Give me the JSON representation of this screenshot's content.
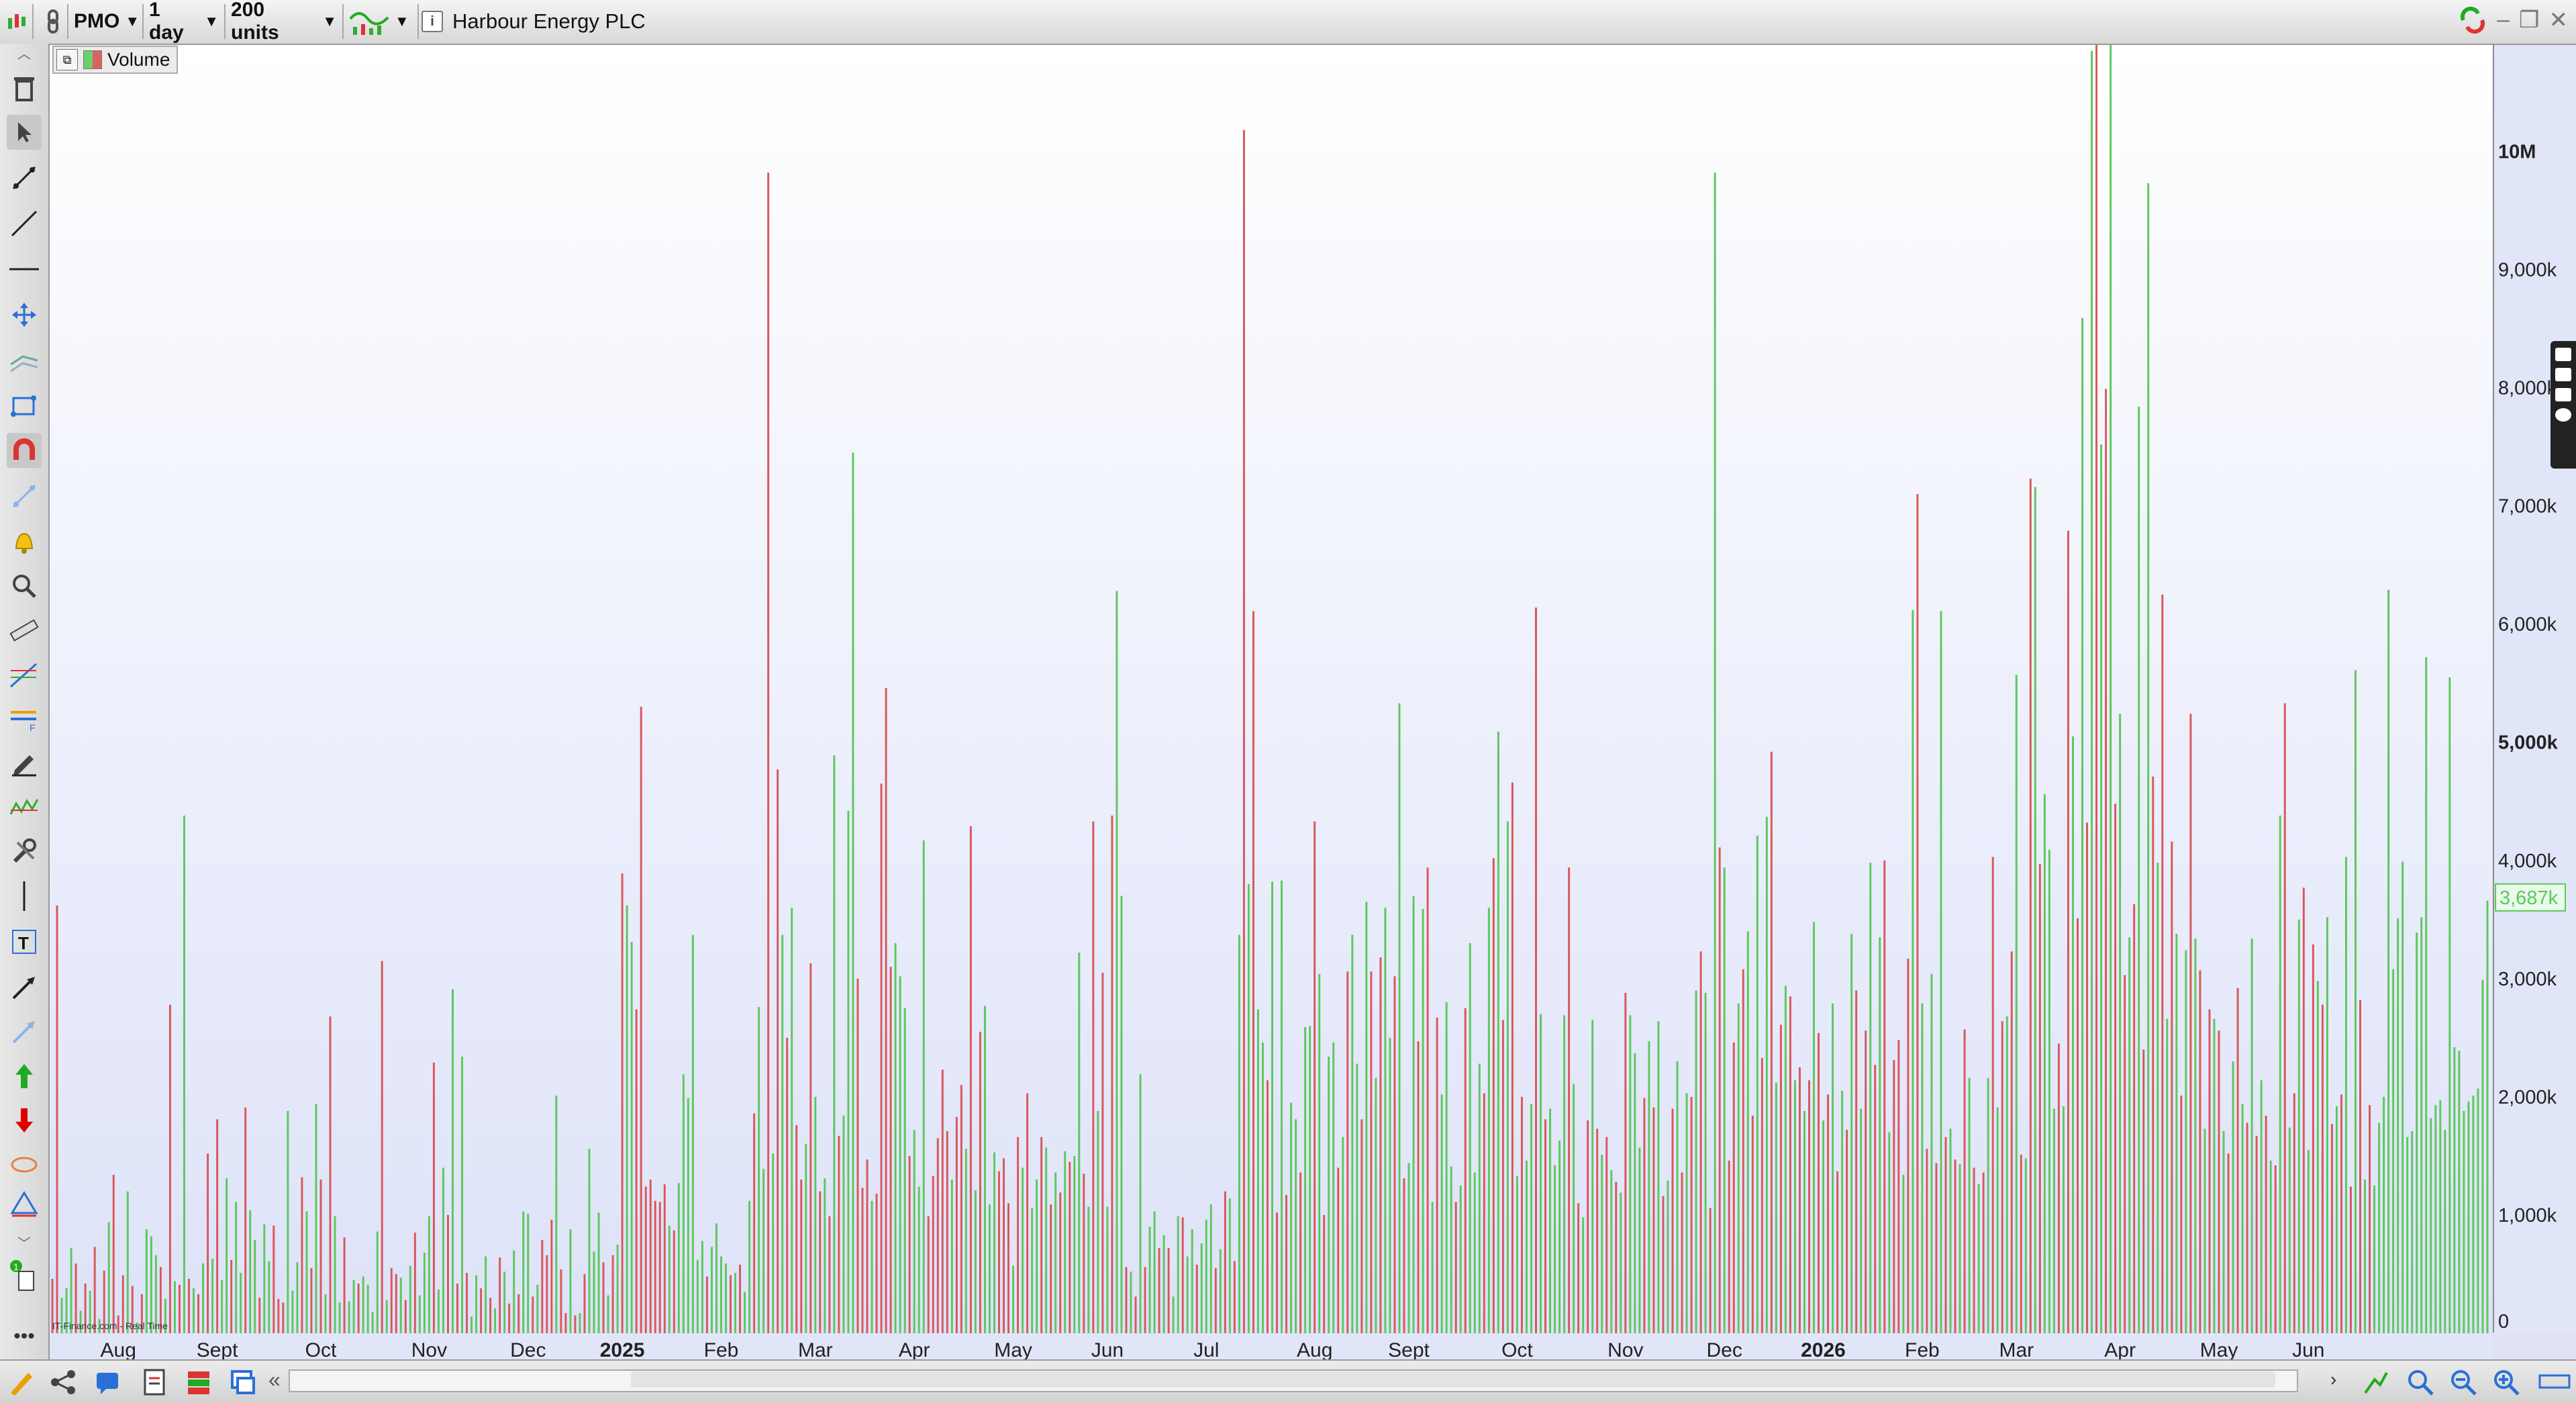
{
  "toolbar": {
    "symbol": "PMO",
    "interval": "1 day",
    "units": "200 units",
    "title": "Harbour Energy PLC"
  },
  "legend": {
    "label": "Volume"
  },
  "credit": "IT-Finance.com - Real Time",
  "colors": {
    "up": "#5cc85c",
    "down": "#d9575b",
    "current": "#5cc85c"
  },
  "chart_data": {
    "type": "bar",
    "title": "",
    "xlabel": "",
    "ylabel": "",
    "ylim": [
      0,
      10900000
    ],
    "y_ticks": [
      {
        "value": 0,
        "label": "0"
      },
      {
        "value": 1000000,
        "label": "1,000k"
      },
      {
        "value": 2000000,
        "label": "2,000k"
      },
      {
        "value": 3000000,
        "label": "3,000k"
      },
      {
        "value": 4000000,
        "label": "4,000k"
      },
      {
        "value": 5000000,
        "label": "5,000k"
      },
      {
        "value": 6000000,
        "label": "6,000k"
      },
      {
        "value": 7000000,
        "label": "7,000k"
      },
      {
        "value": 8000000,
        "label": "8,000k"
      },
      {
        "value": 9000000,
        "label": "9,000k"
      },
      {
        "value": 10000000,
        "label": "10M"
      }
    ],
    "bold_ticks": [
      "5,000k",
      "10M"
    ],
    "current_value_label": "3,687k",
    "current_value": 3687000,
    "x_ticks": [
      {
        "label": "Aug",
        "index": 14
      },
      {
        "label": "Sept",
        "index": 35
      },
      {
        "label": "Oct",
        "index": 57
      },
      {
        "label": "Nov",
        "index": 80
      },
      {
        "label": "Dec",
        "index": 101
      },
      {
        "label": "2025",
        "index": 121
      },
      {
        "label": "Feb",
        "index": 142
      },
      {
        "label": "Mar",
        "index": 162
      },
      {
        "label": "Apr",
        "index": 183
      },
      {
        "label": "May",
        "index": 204
      },
      {
        "label": "Jun",
        "index": 224
      },
      {
        "label": "Jul",
        "index": 245
      },
      {
        "label": "Aug",
        "index": 268
      },
      {
        "label": "Sept",
        "index": 288
      },
      {
        "label": "Oct",
        "index": 311
      },
      {
        "label": "Nov",
        "index": 334
      },
      {
        "label": "Dec",
        "index": 355
      },
      {
        "label": "2026",
        "index": 376
      },
      {
        "label": "Feb",
        "index": 397
      },
      {
        "label": "Mar",
        "index": 417
      },
      {
        "label": "Apr",
        "index": 439
      },
      {
        "label": "May",
        "index": 460
      },
      {
        "label": "Jun",
        "index": 479
      }
    ],
    "bold_x_ticks": [
      "2025",
      "2026"
    ],
    "series": [
      {
        "values": [
          460,
          3620,
          300,
          380,
          720,
          590,
          190,
          420,
          360,
          730,
          120,
          530,
          940,
          1340,
          150,
          490,
          1200,
          400,
          90,
          330,
          880,
          820,
          660,
          560,
          290,
          2780,
          440,
          410,
          4380,
          460,
          380,
          330,
          590,
          1520,
          630,
          1810,
          450,
          1310,
          620,
          1110,
          510,
          1910,
          1040,
          790,
          300,
          920,
          610,
          910,
          290,
          260,
          1880,
          360,
          600,
          1320,
          1030,
          550,
          1940,
          1300,
          330,
          2680,
          990,
          260,
          810,
          270,
          450,
          420,
          480,
          410,
          180,
          860,
          3150,
          280,
          550,
          500,
          470,
          280,
          570,
          850,
          320,
          680,
          990,
          2290,
          370,
          1400,
          1000,
          2910,
          420,
          2340,
          510,
          140,
          490,
          380,
          650,
          300,
          210,
          640,
          520,
          250,
          700,
          330,
          1030,
          1010,
          310,
          410,
          790,
          660,
          960,
          2010,
          540,
          170,
          880,
          150,
          170,
          500,
          1560,
          690,
          1020,
          600,
          320,
          660,
          750,
          3890,
          3620,
          3310,
          2740,
          5300,
          1240,
          1300,
          1120,
          1110,
          1260,
          910,
          870,
          1270,
          2190,
          1990,
          3370,
          620,
          780,
          480,
          730,
          930,
          650,
          590,
          490,
          510,
          580,
          350,
          1120,
          1860,
          2760,
          1390,
          9820,
          1520,
          4770,
          3370,
          2500,
          3600,
          1760,
          1300,
          1600,
          3130,
          2000,
          1200,
          1310,
          990,
          4890,
          1670,
          1840,
          4420,
          7450,
          3000,
          1230,
          1470,
          1120,
          1180,
          4650,
          5460,
          3100,
          3300,
          3020,
          2750,
          1500,
          1720,
          1240,
          4170,
          990,
          1330,
          1650,
          2230,
          1710,
          1300,
          1830,
          2100,
          1560,
          4290,
          1210,
          2550,
          2770,
          1090,
          1530,
          1370,
          1480,
          1100,
          570,
          1660,
          1400,
          2030,
          1060,
          1300,
          1660,
          1570,
          1090,
          1360,
          1190,
          1540,
          1450,
          1500,
          3220,
          1350,
          1070,
          4330,
          1880,
          3050,
          1070,
          4380,
          6280,
          3700,
          560,
          520,
          310,
          2190,
          560,
          900,
          1030,
          720,
          830,
          720,
          310,
          990,
          980,
          650,
          880,
          580,
          760,
          960,
          1090,
          550,
          710,
          1200,
          1140,
          610,
          3370,
          10180,
          3800,
          6110,
          2740,
          2460,
          2140,
          3820,
          1020,
          3830,
          1170,
          1950,
          1810,
          1360,
          2590,
          2600,
          4330,
          3040,
          1000,
          2340,
          2460,
          1400,
          1660,
          3060,
          3370,
          2280,
          1810,
          3650,
          3060,
          2160,
          3180,
          3600,
          2500,
          3020,
          5330,
          1310,
          1440,
          3700,
          2470,
          3590,
          3940,
          1110,
          2670,
          2020,
          2800,
          1410,
          1110,
          1250,
          2750,
          3300,
          1360,
          2280,
          2030,
          3600,
          4020,
          5090,
          2650,
          4330,
          4660,
          1330,
          2000,
          1460,
          1940,
          6140,
          2700,
          1810,
          1900,
          1420,
          1630,
          2690,
          3940,
          2110,
          1100,
          980,
          1800,
          2650,
          1730,
          1510,
          1660,
          1380,
          1280,
          1190,
          2880,
          2690,
          2370,
          1570,
          1990,
          2470,
          1910,
          2640,
          1160,
          1290,
          1900,
          2300,
          1360,
          2030,
          2000,
          2900,
          3230,
          2880,
          1060,
          9820,
          4110,
          3940,
          1460,
          2460,
          2790,
          3080,
          3400,
          1840,
          4210,
          2330,
          4370,
          4920,
          2120,
          2610,
          2940,
          2850,
          2140,
          2250,
          1880,
          2140,
          3480,
          2540,
          1800,
          2020,
          2790,
          1370,
          2050,
          1720,
          3380,
          2900,
          1900,
          2560,
          3980,
          2270,
          3350,
          4000,
          1700,
          2310,
          2480,
          1340,
          3170,
          6120,
          7100,
          2790,
          1560,
          3040,
          1440,
          6110,
          1660,
          1730,
          1470,
          1430,
          2570,
          2160,
          1400,
          1260,
          1360,
          2160,
          4030,
          1910,
          2640,
          2680,
          3230,
          5570,
          1510,
          1480,
          7230,
          7160,
          3970,
          4560,
          4090,
          1900,
          2450,
          1920,
          6790,
          5050,
          3510,
          8590,
          4320,
          10850,
          11160,
          7520,
          7990,
          10900,
          4480,
          5240,
          3030,
          3350,
          3630,
          7840,
          2400,
          9730,
          4710,
          3980,
          6250,
          2660,
          4160,
          3380,
          2010,
          3240,
          5240,
          3340,
          3070,
          1730,
          2740,
          2660,
          2560,
          1710,
          1520,
          2300,
          2920,
          1940,
          1780,
          3340,
          1670,
          2140,
          1840,
          1460,
          1420,
          4380,
          5330,
          1740,
          2030,
          3500,
          3770,
          1550,
          3290,
          2980,
          2780,
          3520,
          1770,
          1920,
          2020,
          4030,
          1240,
          5610,
          2820,
          1300,
          1930,
          1250,
          1780,
          2000,
          6290,
          3080,
          3510,
          3990,
          1660,
          1710,
          3390,
          3520,
          5720,
          1820,
          1930,
          1970,
          1720,
          5550,
          2420,
          2390,
          1880,
          1960,
          2010,
          2070,
          2990,
          3660
        ],
        "directions": "ddgggdgdgdgdgdddgdgdgggdgdgdgdgdgdgdggdggdggdggdddgggdgdgdgdggdggdggggdgddgdgdgggdggdgdgdggdgdgdgdgdggdgdddgddgdgdgggdgdgdggdddddddgdggggggdggggdgdggdggdgdgdgddgdgdgdgdgggdddgddddgggdgggdddddgddgdgdgggdddgdgdggdgdgdgdggdgdgdgdggdgdgdggdgdggdggdgggdgdgdgdgdggdgdgdggdggdgdggdgdggdgdgdggdgdggdgdgdgggdgdgggdgdgdgdgdggdgdggggdgdgdgdgdgdgdgggdgdgdgdgdgdgdgdgdgddgdgdgdgdgdgdgdgdgdgdgdgdgdgdgdgdgddgdgdgdgdgdgdgdgdgdgdgdgdgdgdgdgggdgdgdgdgdgdgdgdgdgdgdgdgdgdgdgdgdgdgdgdgdgdgdgdgdgdgdgdgdgdgdgdgdgdgg"
      }
    ],
    "grid": false,
    "legend": "top-left"
  }
}
